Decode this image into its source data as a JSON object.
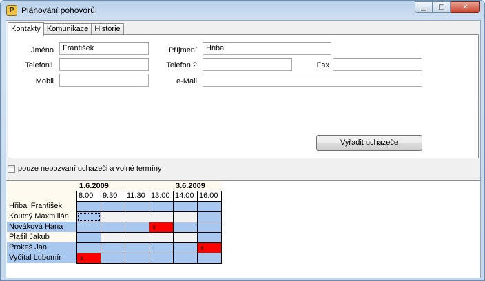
{
  "window": {
    "title": "Plánování pohovorů",
    "icon_letter": "P",
    "min_glyph": "▁",
    "max_glyph": "□",
    "close_glyph": "✕"
  },
  "tabs": [
    "Kontakty",
    "Komunikace",
    "Historie"
  ],
  "form": {
    "jmeno_label": "Jméno",
    "jmeno_value": "František",
    "prijmeni_label": "Příjmení",
    "prijmeni_value": "Hřibal",
    "telefon1_label": "Telefon1",
    "telefon1_value": "",
    "telefon2_label": "Telefon 2",
    "telefon2_value": "",
    "fax_label": "Fax",
    "fax_value": "",
    "mobil_label": "Mobil",
    "mobil_value": "",
    "email_label": "e-Mail",
    "email_value": ""
  },
  "remove_button": "Vyřadit uchazeče",
  "filter_checkbox": {
    "label": "pouze nepozvaní uchazeči a volné termíny",
    "checked": false
  },
  "schedule": {
    "dates": [
      {
        "label": "1.6.2009",
        "span": 4
      },
      {
        "label": "3.6.2009",
        "span": 2
      }
    ],
    "times": [
      "8:00",
      "9:30",
      "11:30",
      "13:00",
      "14:00",
      "16:00"
    ],
    "applicants": [
      "Hřibal František",
      "Koutný Maxmilián",
      "Nováková Hana",
      "Plašil Jakub",
      "Prokeš Jan",
      "Vyčítal Lubomír"
    ],
    "selected_rows": [
      2,
      4,
      5
    ],
    "booked": [
      {
        "row": 2,
        "col": 3,
        "mark": "x"
      },
      {
        "row": 4,
        "col": 5,
        "mark": "x"
      },
      {
        "row": 5,
        "col": 0,
        "mark": "x"
      }
    ],
    "colors": {
      "free": "#a8c8f0",
      "unavailable": "#f2f2f2",
      "booked": "#ff0000",
      "selected_row": "#a8c8f0",
      "header_bg": "#fffaf0"
    },
    "unavailable_cells": [
      [
        1,
        1
      ],
      [
        1,
        2
      ],
      [
        1,
        3
      ],
      [
        1,
        4
      ],
      [
        3,
        1
      ],
      [
        3,
        2
      ],
      [
        3,
        3
      ],
      [
        3,
        4
      ]
    ]
  }
}
